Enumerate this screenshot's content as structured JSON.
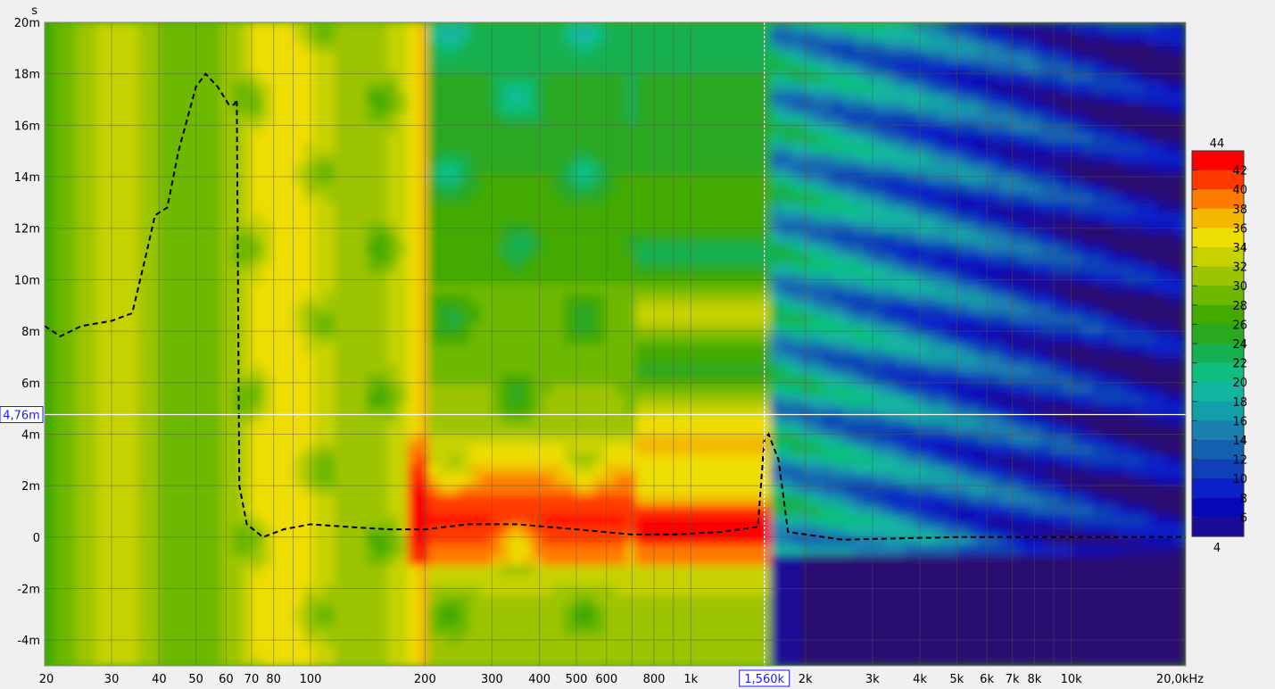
{
  "chart_data": {
    "type": "heatmap",
    "title": "",
    "x_unit_label": "20,0kHz",
    "y_unit_label": "s",
    "x_scale": "log",
    "xlim": [
      20,
      20000
    ],
    "ylim": [
      -0.005,
      0.02
    ],
    "x_ticks": [
      {
        "v": 20,
        "t": "20"
      },
      {
        "v": 30,
        "t": "30"
      },
      {
        "v": 40,
        "t": "40"
      },
      {
        "v": 50,
        "t": "50"
      },
      {
        "v": 60,
        "t": "60"
      },
      {
        "v": 70,
        "t": "70"
      },
      {
        "v": 80,
        "t": "80"
      },
      {
        "v": 100,
        "t": "100"
      },
      {
        "v": 200,
        "t": "200"
      },
      {
        "v": 300,
        "t": "300"
      },
      {
        "v": 400,
        "t": "400"
      },
      {
        "v": 500,
        "t": "500"
      },
      {
        "v": 600,
        "t": "600"
      },
      {
        "v": 800,
        "t": "800"
      },
      {
        "v": 1000,
        "t": "1k"
      },
      {
        "v": 2000,
        "t": "2k"
      },
      {
        "v": 3000,
        "t": "3k"
      },
      {
        "v": 4000,
        "t": "4k"
      },
      {
        "v": 5000,
        "t": "5k"
      },
      {
        "v": 6000,
        "t": "6k"
      },
      {
        "v": 7000,
        "t": "7k"
      },
      {
        "v": 8000,
        "t": "8k"
      },
      {
        "v": 10000,
        "t": "10k"
      },
      {
        "v": 20000,
        "t": "20,0kHz"
      }
    ],
    "x_minor_ticks": [
      90,
      700,
      900,
      9000
    ],
    "y_ticks": [
      {
        "v": 0.02,
        "t": "20m"
      },
      {
        "v": 0.018,
        "t": "18m"
      },
      {
        "v": 0.016,
        "t": "16m"
      },
      {
        "v": 0.014,
        "t": "14m"
      },
      {
        "v": 0.012,
        "t": "12m"
      },
      {
        "v": 0.01,
        "t": "10m"
      },
      {
        "v": 0.008,
        "t": "8m"
      },
      {
        "v": 0.006,
        "t": "6m"
      },
      {
        "v": 0.004,
        "t": "4m"
      },
      {
        "v": 0.002,
        "t": "2m"
      },
      {
        "v": 0,
        "t": "0"
      },
      {
        "v": -0.002,
        "t": "-2m"
      },
      {
        "v": -0.004,
        "t": "-4m"
      }
    ],
    "cursor": {
      "x": 1560,
      "x_label": "1,560k",
      "y": 0.00476,
      "y_label": "4,76m"
    },
    "colorbar": {
      "min": 4,
      "max": 44,
      "min_label": "4",
      "max_label": "44",
      "levels": [
        {
          "v": 44,
          "color": "#ff0000"
        },
        {
          "v": 42,
          "color": "#ff3a00"
        },
        {
          "v": 40,
          "color": "#ff7a00"
        },
        {
          "v": 38,
          "color": "#f2b800"
        },
        {
          "v": 36,
          "color": "#eedd00"
        },
        {
          "v": 34,
          "color": "#c6d200"
        },
        {
          "v": 32,
          "color": "#9cc400"
        },
        {
          "v": 30,
          "color": "#6db800"
        },
        {
          "v": 28,
          "color": "#43aa00"
        },
        {
          "v": 26,
          "color": "#2aa820"
        },
        {
          "v": 24,
          "color": "#16b050"
        },
        {
          "v": 22,
          "color": "#10bf80"
        },
        {
          "v": 20,
          "color": "#12b5a0"
        },
        {
          "v": 18,
          "color": "#129fa8"
        },
        {
          "v": 16,
          "color": "#1a80b0"
        },
        {
          "v": 14,
          "color": "#1660b0"
        },
        {
          "v": 12,
          "color": "#1040b8"
        },
        {
          "v": 10,
          "color": "#0a20c8"
        },
        {
          "v": 8,
          "color": "#0808b8"
        },
        {
          "v": 6,
          "color": "#1a0c98"
        },
        {
          "v": 4,
          "color": "#2a0f70"
        }
      ],
      "tick_values": [
        42,
        40,
        38,
        36,
        34,
        32,
        30,
        28,
        26,
        24,
        22,
        20,
        18,
        16,
        14,
        12,
        10,
        8,
        6
      ]
    },
    "group_delay_curve": [
      {
        "f": 20,
        "t": 0.0082
      },
      {
        "f": 22,
        "t": 0.0078
      },
      {
        "f": 25,
        "t": 0.0082
      },
      {
        "f": 30,
        "t": 0.0084
      },
      {
        "f": 34,
        "t": 0.0087
      },
      {
        "f": 37,
        "t": 0.011
      },
      {
        "f": 39,
        "t": 0.0125
      },
      {
        "f": 42,
        "t": 0.0128
      },
      {
        "f": 45,
        "t": 0.015
      },
      {
        "f": 50,
        "t": 0.0175
      },
      {
        "f": 53,
        "t": 0.018
      },
      {
        "f": 57,
        "t": 0.0175
      },
      {
        "f": 61,
        "t": 0.0168
      },
      {
        "f": 63,
        "t": 0.0168
      },
      {
        "f": 64,
        "t": 0.017
      },
      {
        "f": 65,
        "t": 0.002
      },
      {
        "f": 68,
        "t": 0.0005
      },
      {
        "f": 75,
        "t": 0.0
      },
      {
        "f": 85,
        "t": 0.0003
      },
      {
        "f": 100,
        "t": 0.0005
      },
      {
        "f": 125,
        "t": 0.0004
      },
      {
        "f": 160,
        "t": 0.0003
      },
      {
        "f": 200,
        "t": 0.0003
      },
      {
        "f": 260,
        "t": 0.0005
      },
      {
        "f": 350,
        "t": 0.0005
      },
      {
        "f": 500,
        "t": 0.0003
      },
      {
        "f": 700,
        "t": 0.0001
      },
      {
        "f": 900,
        "t": 0.0001
      },
      {
        "f": 1200,
        "t": 0.0002
      },
      {
        "f": 1500,
        "t": 0.0004
      },
      {
        "f": 1560,
        "t": 0.0038
      },
      {
        "f": 1600,
        "t": 0.004
      },
      {
        "f": 1700,
        "t": 0.003
      },
      {
        "f": 1800,
        "t": 0.0002
      },
      {
        "f": 2500,
        "t": -0.0001
      },
      {
        "f": 5000,
        "t": 0.0
      },
      {
        "f": 10000,
        "t": 0.0
      },
      {
        "f": 20000,
        "t": 0.0
      }
    ]
  }
}
